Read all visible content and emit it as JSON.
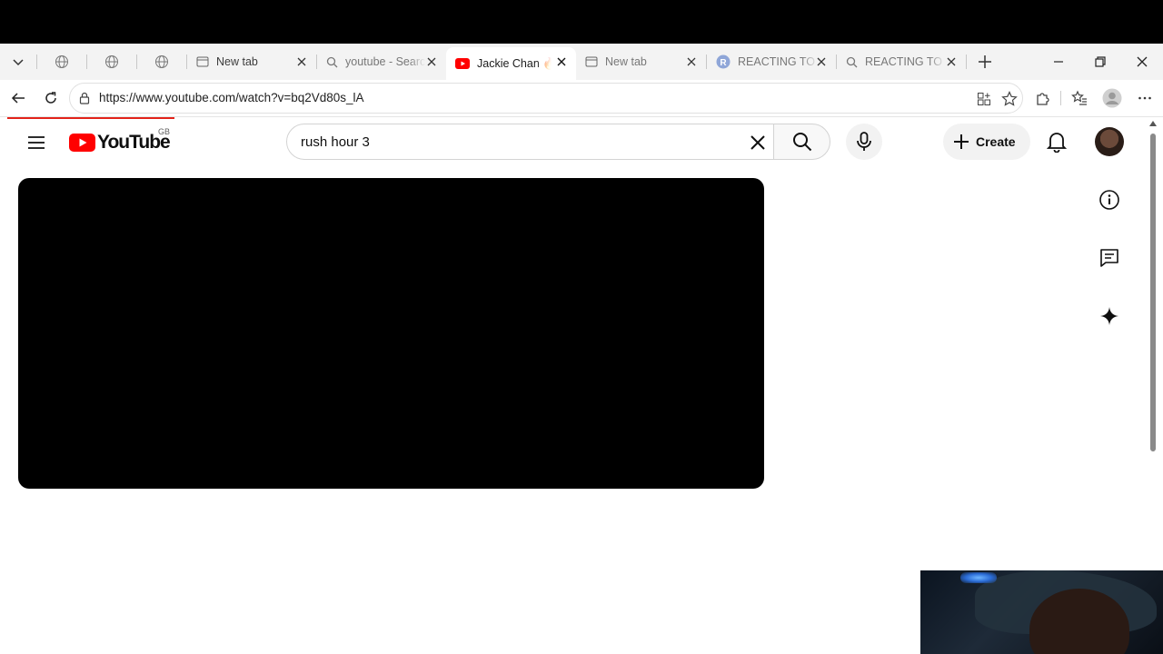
{
  "browser": {
    "tabs": [
      {
        "title": "New tab",
        "icon": "newtab-page-icon"
      },
      {
        "title": "youtube - Search",
        "icon": "search-icon"
      },
      {
        "title": "Jackie Chan 🔥 [",
        "icon": "youtube-favicon",
        "active": true
      },
      {
        "title": "New tab",
        "icon": "newtab-page-icon"
      },
      {
        "title": "REACTING TO U",
        "icon": "r-favicon"
      },
      {
        "title": "REACTING TO U",
        "icon": "search-icon"
      }
    ],
    "url": "https://www.youtube.com/watch?v=bq2Vd80s_lA"
  },
  "youtube": {
    "logo_text": "YouTube",
    "region": "GB",
    "search_query": "rush hour 3",
    "create_label": "Create"
  },
  "colors": {
    "youtube_red": "#ff0000",
    "loading_bar": "#e2231a"
  }
}
